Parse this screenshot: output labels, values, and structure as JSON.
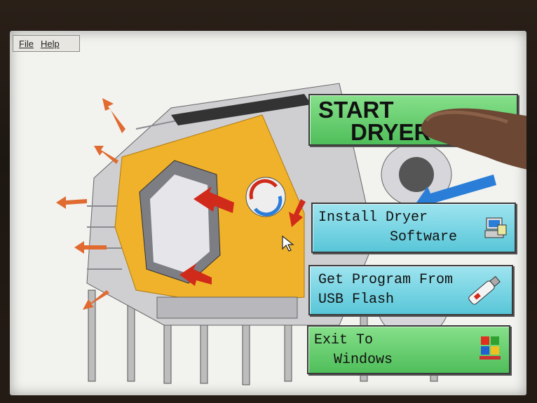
{
  "menu": {
    "file": "File",
    "help": "Help"
  },
  "buttons": {
    "start_line1": "START",
    "start_line2": "DRYER",
    "install_line1": "Install Dryer",
    "install_line2": "Software",
    "usb_line1": "Get Program From",
    "usb_line2": "USB Flash",
    "exit_line1": "Exit To",
    "exit_line2": "Windows"
  },
  "icons": [
    "computer-install-icon",
    "usb-flash-icon",
    "windows-logo-icon",
    "mouse-pointer-icon"
  ],
  "colors": {
    "green_button": "#4fbe5a",
    "blue_button": "#58c6d8",
    "insulation": "#f0b22a",
    "arrow_red": "#d02a1a",
    "arrow_orange": "#e06a30",
    "arrow_blue": "#2a7ed8"
  }
}
